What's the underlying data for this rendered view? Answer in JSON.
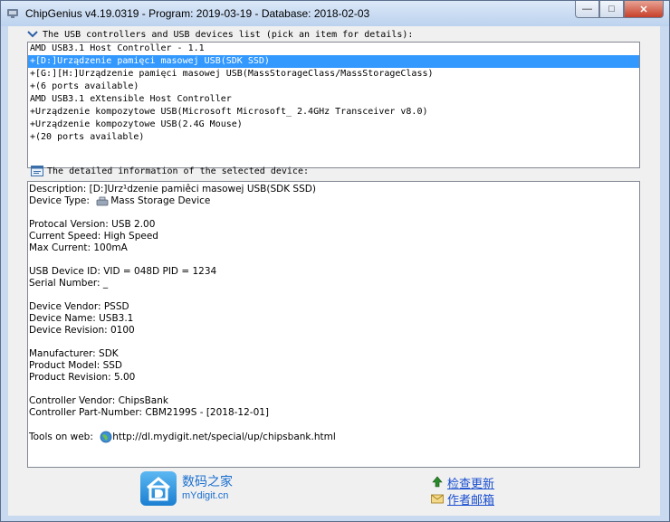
{
  "window": {
    "title": "ChipGenius v4.19.0319 - Program: 2019-03-19 - Database: 2018-02-03",
    "minimize_glyph": "—",
    "maximize_glyph": "□",
    "close_glyph": "✕"
  },
  "usb_list": {
    "label": "The USB controllers and USB devices list (pick an item for details):",
    "items": [
      {
        "text": "AMD USB3.1 Host Controller - 1.1",
        "selected": false
      },
      {
        "text": "+[D:]Urządzenie pamięci masowej USB(SDK SSD)",
        "selected": true
      },
      {
        "text": "+[G:][H:]Urządzenie pamięci masowej USB(MassStorageClass/MassStorageClass)",
        "selected": false
      },
      {
        "text": "+(6 ports available)",
        "selected": false
      },
      {
        "text": "AMD USB3.1 eXtensible Host Controller",
        "selected": false
      },
      {
        "text": "+Urządzenie kompozytowe USB(Microsoft Microsoft_ 2.4GHz Transceiver v8.0)",
        "selected": false
      },
      {
        "text": "+Urządzenie kompozytowe USB(2.4G Mouse)",
        "selected": false
      },
      {
        "text": "+(20 ports available)",
        "selected": false
      }
    ]
  },
  "details": {
    "label": "The detailed information of the selected device:",
    "description": "Description: [D:]Urz¹dzenie pamiêci masowej USB(SDK SSD)",
    "device_type_label": "Device Type:",
    "device_type_value": "Mass Storage Device",
    "protocol_version": "Protocal Version: USB 2.00",
    "current_speed": "Current Speed: High Speed",
    "max_current": "Max Current: 100mA",
    "usb_device_id": "USB Device ID: VID = 048D PID = 1234",
    "serial_number": "Serial Number: _",
    "device_vendor": "Device Vendor: PSSD",
    "device_name": "Device Name: USB3.1",
    "device_revision": "Device Revision: 0100",
    "manufacturer": "Manufacturer: SDK",
    "product_model": "Product Model: SSD",
    "product_revision": "Product Revision: 5.00",
    "controller_vendor": "Controller Vendor: ChipsBank",
    "controller_part_number": "Controller Part-Number: CBM2199S - [2018-12-01]",
    "tools_label": "Tools on web:",
    "tools_url": "http://dl.mydigit.net/special/up/chipsbank.html"
  },
  "footer": {
    "logo_cn": "数码之家",
    "logo_url": "mYdigit.cn",
    "check_update": "检查更新",
    "author_email": "作者邮箱"
  }
}
